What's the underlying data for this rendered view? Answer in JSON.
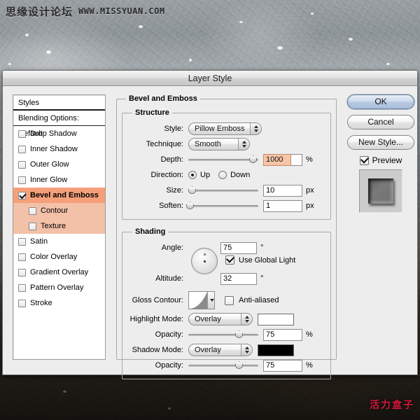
{
  "watermarks": {
    "top": "思缘设计论坛",
    "top_url": "WWW.MISSYUAN.COM",
    "bottom": "活力盒子"
  },
  "dialog": {
    "title": "Layer Style"
  },
  "styles_panel": {
    "header": "Styles",
    "blending_options": "Blending Options: Default",
    "items": [
      {
        "label": "Drop Shadow",
        "checked": false,
        "sub": false,
        "selected": false
      },
      {
        "label": "Inner Shadow",
        "checked": false,
        "sub": false,
        "selected": false
      },
      {
        "label": "Outer Glow",
        "checked": false,
        "sub": false,
        "selected": false
      },
      {
        "label": "Inner Glow",
        "checked": false,
        "sub": false,
        "selected": false
      },
      {
        "label": "Bevel and Emboss",
        "checked": true,
        "sub": false,
        "selected": true
      },
      {
        "label": "Contour",
        "checked": false,
        "sub": true,
        "selected": false
      },
      {
        "label": "Texture",
        "checked": false,
        "sub": true,
        "selected": false
      },
      {
        "label": "Satin",
        "checked": false,
        "sub": false,
        "selected": false
      },
      {
        "label": "Color Overlay",
        "checked": false,
        "sub": false,
        "selected": false
      },
      {
        "label": "Gradient Overlay",
        "checked": false,
        "sub": false,
        "selected": false
      },
      {
        "label": "Pattern Overlay",
        "checked": false,
        "sub": false,
        "selected": false
      },
      {
        "label": "Stroke",
        "checked": false,
        "sub": false,
        "selected": false
      }
    ]
  },
  "panel": {
    "title": "Bevel and Emboss",
    "structure": {
      "legend": "Structure",
      "style_label": "Style:",
      "style_value": "Pillow Emboss",
      "technique_label": "Technique:",
      "technique_value": "Smooth",
      "depth_label": "Depth:",
      "depth_value": "1000",
      "depth_unit": "%",
      "depth_slider_pct": 92,
      "direction_label": "Direction:",
      "direction_up": "Up",
      "direction_down": "Down",
      "direction_selected": "Up",
      "size_label": "Size:",
      "size_value": "10",
      "size_unit": "px",
      "size_slider_pct": 5,
      "soften_label": "Soften:",
      "soften_value": "1",
      "soften_unit": "px",
      "soften_slider_pct": 2
    },
    "shading": {
      "legend": "Shading",
      "angle_label": "Angle:",
      "angle_value": "75",
      "angle_unit": "°",
      "global_light_label": "Use Global Light",
      "global_light_checked": true,
      "altitude_label": "Altitude:",
      "altitude_value": "32",
      "altitude_unit": "°",
      "gloss_contour_label": "Gloss Contour:",
      "anti_aliased_label": "Anti-aliased",
      "anti_aliased_checked": false,
      "highlight_mode_label": "Highlight Mode:",
      "highlight_mode_value": "Overlay",
      "highlight_color": "#ffffff",
      "highlight_opacity_label": "Opacity:",
      "highlight_opacity_value": "75",
      "highlight_opacity_unit": "%",
      "highlight_opacity_pct": 72,
      "shadow_mode_label": "Shadow Mode:",
      "shadow_mode_value": "Overlay",
      "shadow_color": "#000000",
      "shadow_opacity_label": "Opacity:",
      "shadow_opacity_value": "75",
      "shadow_opacity_unit": "%",
      "shadow_opacity_pct": 72
    }
  },
  "side": {
    "ok": "OK",
    "cancel": "Cancel",
    "new_style": "New Style...",
    "preview_label": "Preview",
    "preview_checked": true
  },
  "colors": {
    "selected_row": "#f5a07a",
    "sub_selected_row": "#f3c0a8",
    "field_selection": "#f7c5a8",
    "dialog_bg": "#ededed",
    "watermark_red": "#d6173a"
  }
}
